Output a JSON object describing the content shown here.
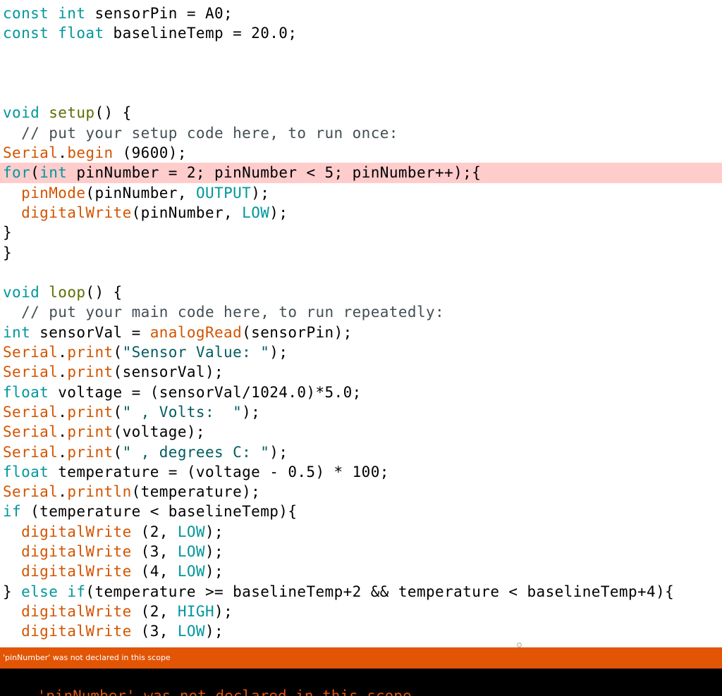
{
  "colors": {
    "keyword": "#00979c",
    "function": "#d35400",
    "declaration": "#5e6d03",
    "constant": "#00979c",
    "string": "#005c5f",
    "comment": "#434f54",
    "highlight_line": "#ffcccc",
    "status_bar": "#e25505",
    "console_bg": "#000000",
    "console_text": "#e25505"
  },
  "editor": {
    "highlighted_line": 8,
    "lines": [
      [
        [
          "kw",
          "const"
        ],
        [
          "p",
          " "
        ],
        [
          "kw",
          "int"
        ],
        [
          "p",
          " sensorPin = A0;"
        ]
      ],
      [
        [
          "kw",
          "const"
        ],
        [
          "p",
          " "
        ],
        [
          "kw",
          "float"
        ],
        [
          "p",
          " baselineTemp = 20.0;"
        ]
      ],
      [],
      [],
      [],
      [
        [
          "kw",
          "void"
        ],
        [
          "p",
          " "
        ],
        [
          "decl",
          "setup"
        ],
        [
          "p",
          "() {"
        ]
      ],
      [
        [
          "cmt",
          "  // put your setup code here, to run once:"
        ]
      ],
      [
        [
          "fn",
          "Serial"
        ],
        [
          "p",
          "."
        ],
        [
          "fn",
          "begin"
        ],
        [
          "p",
          " (9600);"
        ]
      ],
      [
        [
          "kw",
          "for"
        ],
        [
          "p",
          "("
        ],
        [
          "kw",
          "int"
        ],
        [
          "p",
          " pinNumber = 2; pinNumber < 5; pinNumber++);{"
        ]
      ],
      [
        [
          "p",
          "  "
        ],
        [
          "fn",
          "pinMode"
        ],
        [
          "p",
          "(pinNumber, "
        ],
        [
          "const",
          "OUTPUT"
        ],
        [
          "p",
          ");"
        ]
      ],
      [
        [
          "p",
          "  "
        ],
        [
          "fn",
          "digitalWrite"
        ],
        [
          "p",
          "(pinNumber, "
        ],
        [
          "const",
          "LOW"
        ],
        [
          "p",
          ");"
        ]
      ],
      [
        [
          "p",
          "}"
        ]
      ],
      [
        [
          "p",
          "}"
        ]
      ],
      [],
      [
        [
          "kw",
          "void"
        ],
        [
          "p",
          " "
        ],
        [
          "decl",
          "loop"
        ],
        [
          "p",
          "() {"
        ]
      ],
      [
        [
          "cmt",
          "  // put your main code here, to run repeatedly:"
        ]
      ],
      [
        [
          "kw",
          "int"
        ],
        [
          "p",
          " sensorVal = "
        ],
        [
          "fn",
          "analogRead"
        ],
        [
          "p",
          "(sensorPin);"
        ]
      ],
      [
        [
          "fn",
          "Serial"
        ],
        [
          "p",
          "."
        ],
        [
          "fn",
          "print"
        ],
        [
          "p",
          "("
        ],
        [
          "str",
          "\"Sensor Value: \""
        ],
        [
          "p",
          ");"
        ]
      ],
      [
        [
          "fn",
          "Serial"
        ],
        [
          "p",
          "."
        ],
        [
          "fn",
          "print"
        ],
        [
          "p",
          "(sensorVal);"
        ]
      ],
      [
        [
          "kw",
          "float"
        ],
        [
          "p",
          " voltage = (sensorVal/1024.0)*5.0;"
        ]
      ],
      [
        [
          "fn",
          "Serial"
        ],
        [
          "p",
          "."
        ],
        [
          "fn",
          "print"
        ],
        [
          "p",
          "("
        ],
        [
          "str",
          "\" , Volts:  \""
        ],
        [
          "p",
          ");"
        ]
      ],
      [
        [
          "fn",
          "Serial"
        ],
        [
          "p",
          "."
        ],
        [
          "fn",
          "print"
        ],
        [
          "p",
          "(voltage);"
        ]
      ],
      [
        [
          "fn",
          "Serial"
        ],
        [
          "p",
          "."
        ],
        [
          "fn",
          "print"
        ],
        [
          "p",
          "("
        ],
        [
          "str",
          "\" , degrees C: \""
        ],
        [
          "p",
          ");"
        ]
      ],
      [
        [
          "kw",
          "float"
        ],
        [
          "p",
          " temperature = (voltage - 0.5) * 100;"
        ]
      ],
      [
        [
          "fn",
          "Serial"
        ],
        [
          "p",
          "."
        ],
        [
          "fn",
          "println"
        ],
        [
          "p",
          "(temperature);"
        ]
      ],
      [
        [
          "kw",
          "if"
        ],
        [
          "p",
          " (temperature < baselineTemp){"
        ]
      ],
      [
        [
          "p",
          "  "
        ],
        [
          "fn",
          "digitalWrite"
        ],
        [
          "p",
          " (2, "
        ],
        [
          "const",
          "LOW"
        ],
        [
          "p",
          ");"
        ]
      ],
      [
        [
          "p",
          "  "
        ],
        [
          "fn",
          "digitalWrite"
        ],
        [
          "p",
          " (3, "
        ],
        [
          "const",
          "LOW"
        ],
        [
          "p",
          ");"
        ]
      ],
      [
        [
          "p",
          "  "
        ],
        [
          "fn",
          "digitalWrite"
        ],
        [
          "p",
          " (4, "
        ],
        [
          "const",
          "LOW"
        ],
        [
          "p",
          ");"
        ]
      ],
      [
        [
          "p",
          "} "
        ],
        [
          "kw",
          "else"
        ],
        [
          "p",
          " "
        ],
        [
          "kw",
          "if"
        ],
        [
          "p",
          "(temperature >= baselineTemp+2 && temperature < baselineTemp+4){"
        ]
      ],
      [
        [
          "p",
          "  "
        ],
        [
          "fn",
          "digitalWrite"
        ],
        [
          "p",
          " (2, "
        ],
        [
          "const",
          "HIGH"
        ],
        [
          "p",
          ");"
        ]
      ],
      [
        [
          "p",
          "  "
        ],
        [
          "fn",
          "digitalWrite"
        ],
        [
          "p",
          " (3, "
        ],
        [
          "const",
          "LOW"
        ],
        [
          "p",
          ");"
        ]
      ]
    ]
  },
  "status": {
    "message": "'pinNumber' was not declared in this scope"
  },
  "console": {
    "output": "'pinNumber' was not declared in this scope"
  }
}
